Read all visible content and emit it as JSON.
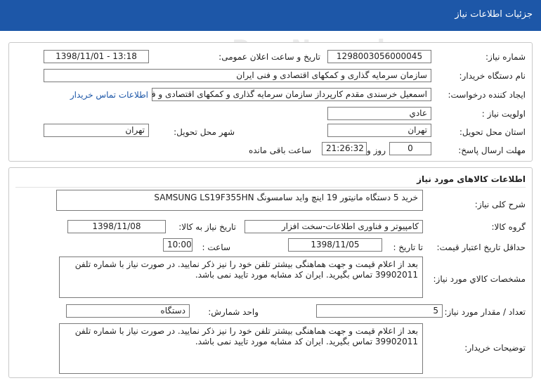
{
  "header": {
    "title": "جزئیات اطلاعات نیاز"
  },
  "watermark": {
    "brand": "ParsNamad",
    "brand_fa": "پارس نماد داده ها",
    "phone": "۰۲۱-۸۸۳۴۹۶۷۰-۵",
    "subtitle": "سامانه اطلاع رسانی مناقصه و مزایده",
    "number": "1881"
  },
  "request_info": {
    "need_number_label": "شماره نیاز:",
    "need_number": "1298003056000045",
    "announce_label": "تاریخ و ساعت اعلان عمومی:",
    "announce_value": "1398/11/01 - 13:18",
    "buyer_org_label": "نام دستگاه خریدار:",
    "buyer_org": "سازمان سرمایه گذاری و کمکهای اقتصادی و فنی ایران",
    "creator_label": "ایجاد کننده درخواست:",
    "creator": "اسمعیل خرسندی مقدم کارپرداز سازمان سرمایه گذاری و کمکهای اقتصادی و فنی ایران",
    "contact_link": "اطلاعات تماس خریدار",
    "priority_label": "اولویت نیاز :",
    "priority": "عادي",
    "province_label": "استان محل تحویل:",
    "province": "تهران",
    "city_label": "شهر محل تحویل:",
    "city": "تهران",
    "deadline_label": "مهلت ارسال پاسخ:",
    "days_value": "0",
    "days_word": "روز و",
    "time_value": "21:26:32",
    "remaining_label": "ساعت باقی مانده"
  },
  "goods": {
    "section_title": "اطلاعات کالاهای مورد نیاز",
    "summary_label": "شرح کلی نیاز:",
    "summary": "خرید 5 دستگاه مانیتور 19 اینچ واید سامسونگ      SAMSUNG      LS19F355HN",
    "group_label": "گروه کالا:",
    "group": "کامپیوتر و فناوری اطلاعات-سخت افزار",
    "need_date_label": "تاریخ نیاز به کالا:",
    "need_date": "1398/11/08",
    "validity_label": "حداقل تاریخ اعتبار قیمت:",
    "until_label": "تا تاریخ :",
    "validity_date": "1398/11/05",
    "hour_label": "ساعت :",
    "validity_time": "10:00",
    "spec_label": "مشخصات کالاي مورد نیاز:",
    "spec": "بعد از اعلام قیمت و جهت هماهنگی بیشتر تلفن خود را نیز ذکر نمایید. در صورت نیاز با شماره تلفن 39902011 تماس بگیرید. ایران کد مشابه مورد تایید نمی باشد.",
    "qty_label": "تعداد / مقدار مورد نیاز:",
    "qty": "5",
    "unit_label": "واحد شمارش:",
    "unit": "دستگاه",
    "buyer_notes_label": "توضیحات خریدار:",
    "buyer_notes": "بعد از اعلام قیمت و جهت هماهنگی بیشتر تلفن خود را نیز ذکر نمایید. در صورت نیاز با شماره تلفن 39902011 تماس بگیرید. ایران کد مشابه مورد تایید نمی باشد."
  }
}
